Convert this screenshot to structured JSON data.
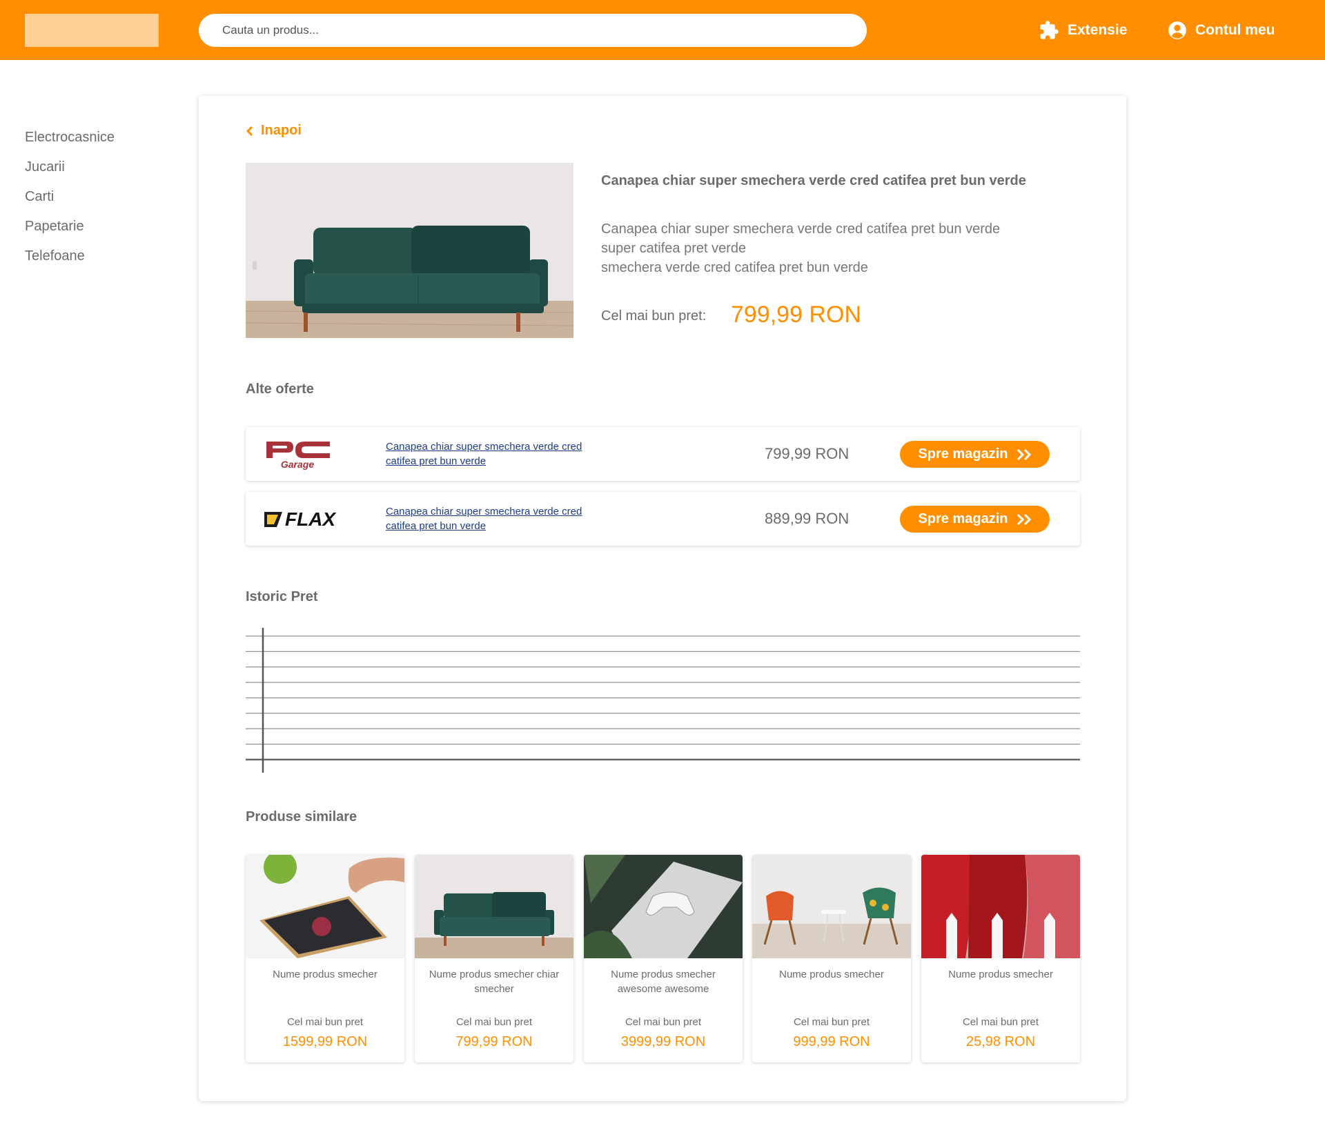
{
  "header": {
    "search_placeholder": "Cauta un produs...",
    "extension_label": "Extensie",
    "account_label": "Contul meu",
    "accent_color": "#ff8f00"
  },
  "sidebar": {
    "items": [
      "Electrocasnice",
      "Jucarii",
      "Carti",
      "Papetarie",
      "Telefoane"
    ]
  },
  "product": {
    "back_label": "Inapoi",
    "title": "Canapea chiar super smechera verde cred catifea pret bun verde",
    "description_lines": [
      "Canapea chiar super smechera verde cred catifea pret bun verde",
      "super catifea pret verde",
      "smechera verde cred catifea pret bun verde"
    ],
    "best_price_label": "Cel mai bun pret:",
    "best_price": "799,99 RON"
  },
  "offers": {
    "title": "Alte oferte",
    "items": [
      {
        "store": "PC Garage",
        "link_text": "Canapea chiar super smechera verde cred catifea pret bun verde",
        "price": "799,99 RON",
        "button": "Spre magazin"
      },
      {
        "store": "FLAX",
        "link_text": "Canapea chiar super smechera verde cred catifea pret bun verde",
        "price": "889,99 RON",
        "button": "Spre magazin"
      }
    ]
  },
  "history": {
    "title": "Istoric Pret",
    "gridlines": 8
  },
  "similar": {
    "title": "Produse similare",
    "items": [
      {
        "name": "Nume produs smecher",
        "label": "Cel mai bun pret",
        "price": "1599,99 RON"
      },
      {
        "name": "Nume produs smecher chiar smecher",
        "label": "Cel mai bun pret",
        "price": "799,99 RON"
      },
      {
        "name": "Nume produs smecher awesome awesome",
        "label": "Cel mai bun pret",
        "price": "3999,99 RON"
      },
      {
        "name": "Nume produs smecher",
        "label": "Cel mai bun pret",
        "price": "999,99 RON"
      },
      {
        "name": "Nume produs smecher",
        "label": "Cel mai bun pret",
        "price": "25,98 RON"
      }
    ]
  }
}
